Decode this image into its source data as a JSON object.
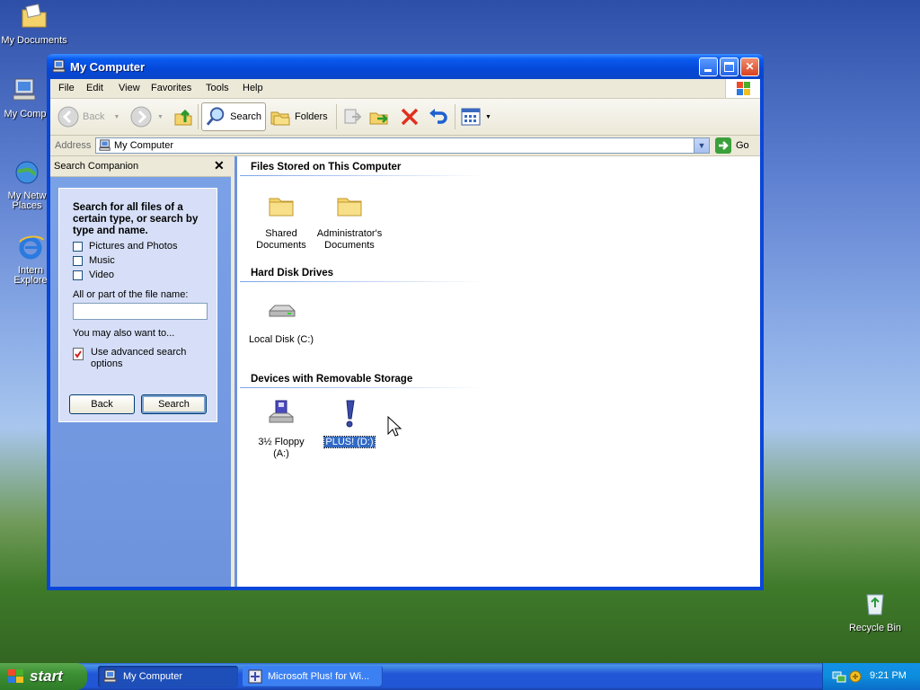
{
  "desktop": {
    "icons": [
      {
        "label": "My Documents"
      },
      {
        "label": "My Comp"
      },
      {
        "label": "My Netw\nPlaces"
      },
      {
        "label": "Intern\nExplore"
      },
      {
        "label": "Recycle Bin"
      }
    ]
  },
  "window": {
    "title": "My Computer",
    "menu": [
      "File",
      "Edit",
      "View",
      "Favorites",
      "Tools",
      "Help"
    ],
    "toolbar": {
      "back": "Back",
      "search": "Search",
      "folders": "Folders"
    },
    "address": {
      "label": "Address",
      "value": "My Computer",
      "go": "Go"
    },
    "search_pane": {
      "title": "Search Companion",
      "heading": "Search for all files of a certain type, or search by type and name.",
      "options": [
        "Pictures and Photos",
        "Music",
        "Video"
      ],
      "filename_label": "All or part of the file name:",
      "also_label": "You may also want to...",
      "advanced_label": "Use advanced search options",
      "back_button": "Back",
      "search_button": "Search"
    },
    "groups": [
      {
        "title": "Files Stored on This Computer",
        "items": [
          "Shared Documents",
          "Administrator's Documents"
        ]
      },
      {
        "title": "Hard Disk Drives",
        "items": [
          "Local Disk (C:)"
        ]
      },
      {
        "title": "Devices with Removable Storage",
        "items": [
          "3½ Floppy (A:)",
          "PLUS! (D:)"
        ]
      }
    ]
  },
  "taskbar": {
    "start": "start",
    "buttons": [
      "My Computer",
      "Microsoft Plus! for Wi..."
    ],
    "clock": "9:21 PM"
  }
}
